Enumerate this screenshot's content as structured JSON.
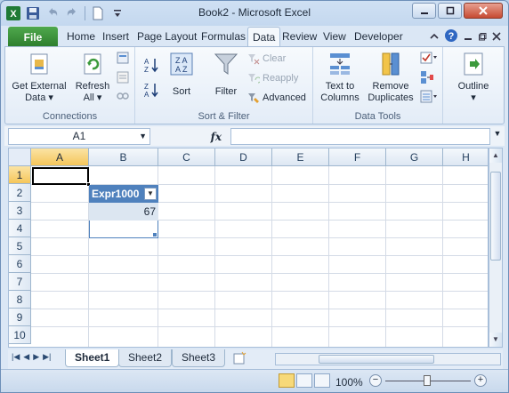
{
  "window": {
    "title": "Book2 - Microsoft Excel"
  },
  "tabs": {
    "file": "File",
    "items": [
      "Home",
      "Insert",
      "Page Layout",
      "Formulas",
      "Data",
      "Review",
      "View",
      "Developer"
    ],
    "active": "Data"
  },
  "ribbon": {
    "connections": {
      "label": "Connections",
      "get_external_l1": "Get External",
      "get_external_l2": "Data",
      "refresh_l1": "Refresh",
      "refresh_l2": "All"
    },
    "sort_filter": {
      "label": "Sort & Filter",
      "sort": "Sort",
      "filter": "Filter",
      "clear": "Clear",
      "reapply": "Reapply",
      "advanced": "Advanced"
    },
    "data_tools": {
      "label": "Data Tools",
      "text_to_columns_l1": "Text to",
      "text_to_columns_l2": "Columns",
      "remove_duplicates_l1": "Remove",
      "remove_duplicates_l2": "Duplicates"
    },
    "outline": {
      "label": "Outline"
    }
  },
  "formula_bar": {
    "name_box": "A1",
    "fx": "fx",
    "formula": ""
  },
  "grid": {
    "columns": [
      "A",
      "B",
      "C",
      "D",
      "E",
      "F",
      "G",
      "H"
    ],
    "rows": [
      "1",
      "2",
      "3",
      "4",
      "5",
      "6",
      "7",
      "8",
      "9",
      "10"
    ],
    "selected_column": "A",
    "selected_row": "1",
    "table_header": "Expr1000",
    "table_value": "67"
  },
  "sheets": {
    "tabs": [
      "Sheet1",
      "Sheet2",
      "Sheet3"
    ],
    "active": "Sheet1"
  },
  "status": {
    "zoom": "100%"
  }
}
